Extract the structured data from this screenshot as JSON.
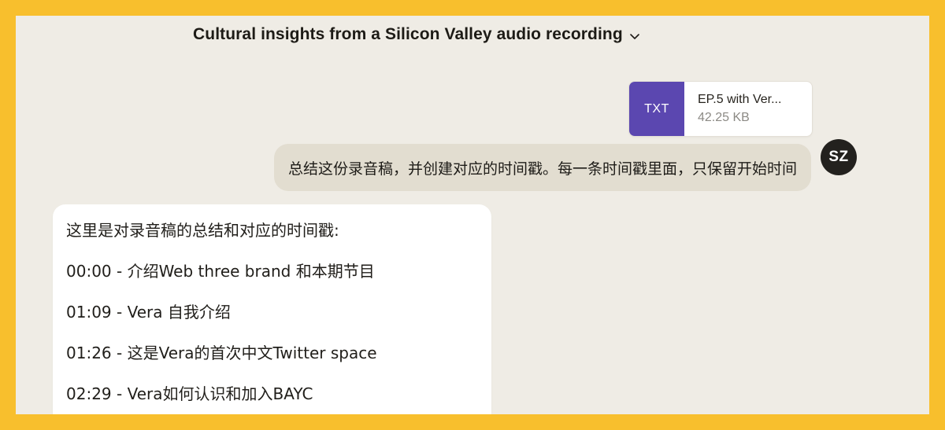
{
  "conversation": {
    "title": "Cultural insights from a Silicon Valley audio recording"
  },
  "attachment": {
    "type_label": "TXT",
    "name": "EP.5 with Ver...",
    "size": "42.25 KB"
  },
  "user": {
    "avatar_initials": "SZ",
    "message": "总结这份录音稿，并创建对应的时间戳。每一条时间戳里面，只保留开始时间"
  },
  "assistant": {
    "intro": "这里是对录音稿的总结和对应的时间戳:",
    "timestamps": [
      "00:00 - 介绍Web three brand 和本期节目",
      "01:09 - Vera 自我介绍",
      "01:26 - 这是Vera的首次中文Twitter space",
      "02:29 - Vera如何认识和加入BAYC"
    ]
  },
  "icons": {
    "title_dropdown": "chevron-down-icon"
  },
  "colors": {
    "frame": "#f8bf2d",
    "background": "#efece5",
    "file_badge": "#5b47b0",
    "user_bubble": "#e2ddd0",
    "avatar": "#23211e"
  }
}
